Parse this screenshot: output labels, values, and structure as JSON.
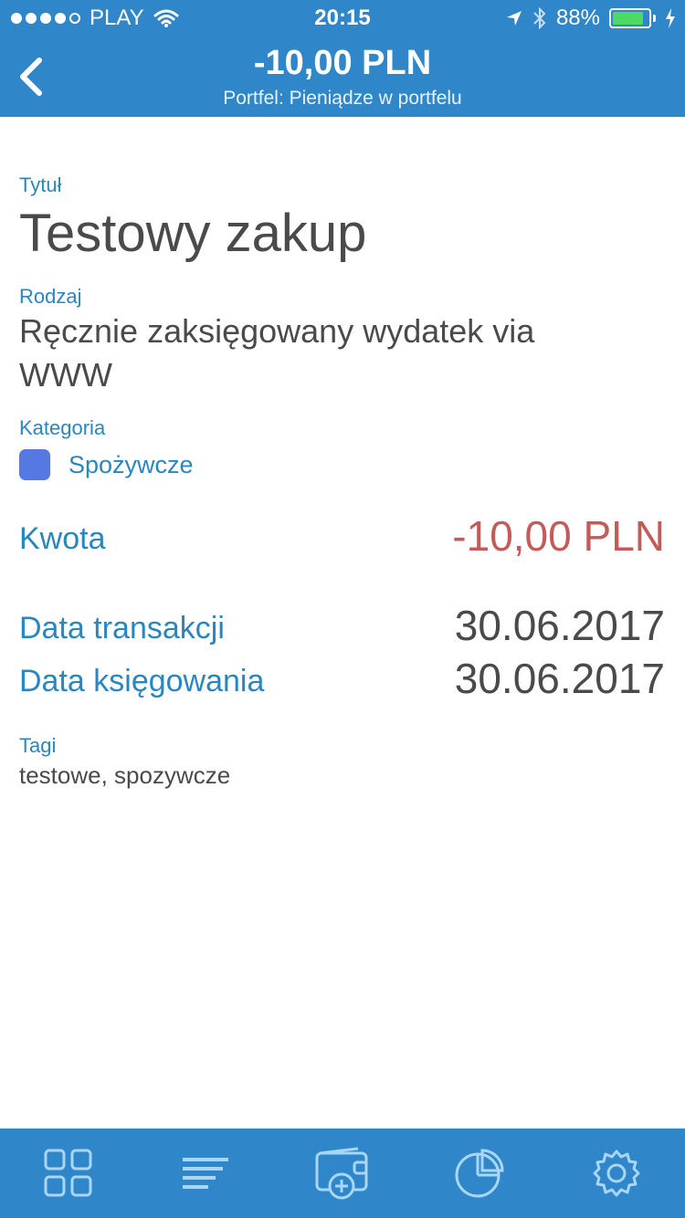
{
  "status_bar": {
    "carrier": "PLAY",
    "time": "20:15",
    "battery_percent": "88%",
    "battery_level": 0.88
  },
  "nav": {
    "title": "-10,00 PLN",
    "subtitle": "Portfel: Pieniądze w portfelu"
  },
  "details": {
    "title_label": "Tytuł",
    "title_value": "Testowy zakup",
    "type_label": "Rodzaj",
    "type_value_line1": "Ręcznie zaksięgowany wydatek via",
    "type_value_line2": "WWW",
    "category_label": "Kategoria",
    "category_value": "Spożywcze",
    "category_color": "#5578e2",
    "amount_label": "Kwota",
    "amount_value": "-10,00 PLN",
    "amount_color": "#c45b5b",
    "transaction_date_label": "Data transakcji",
    "transaction_date_value": "30.06.2017",
    "posting_date_label": "Data księgowania",
    "posting_date_value": "30.06.2017",
    "tags_label": "Tagi",
    "tags_value": "testowe, spozywcze"
  },
  "tabbar": {
    "items": [
      "dashboard-grid-icon",
      "list-icon",
      "add-wallet-icon",
      "pie-chart-icon",
      "settings-gear-icon"
    ]
  },
  "colors": {
    "accent": "#2f86c8",
    "label": "#2a86bf",
    "text": "#4a4a4a",
    "tab_icon": "#a9d6f5"
  }
}
